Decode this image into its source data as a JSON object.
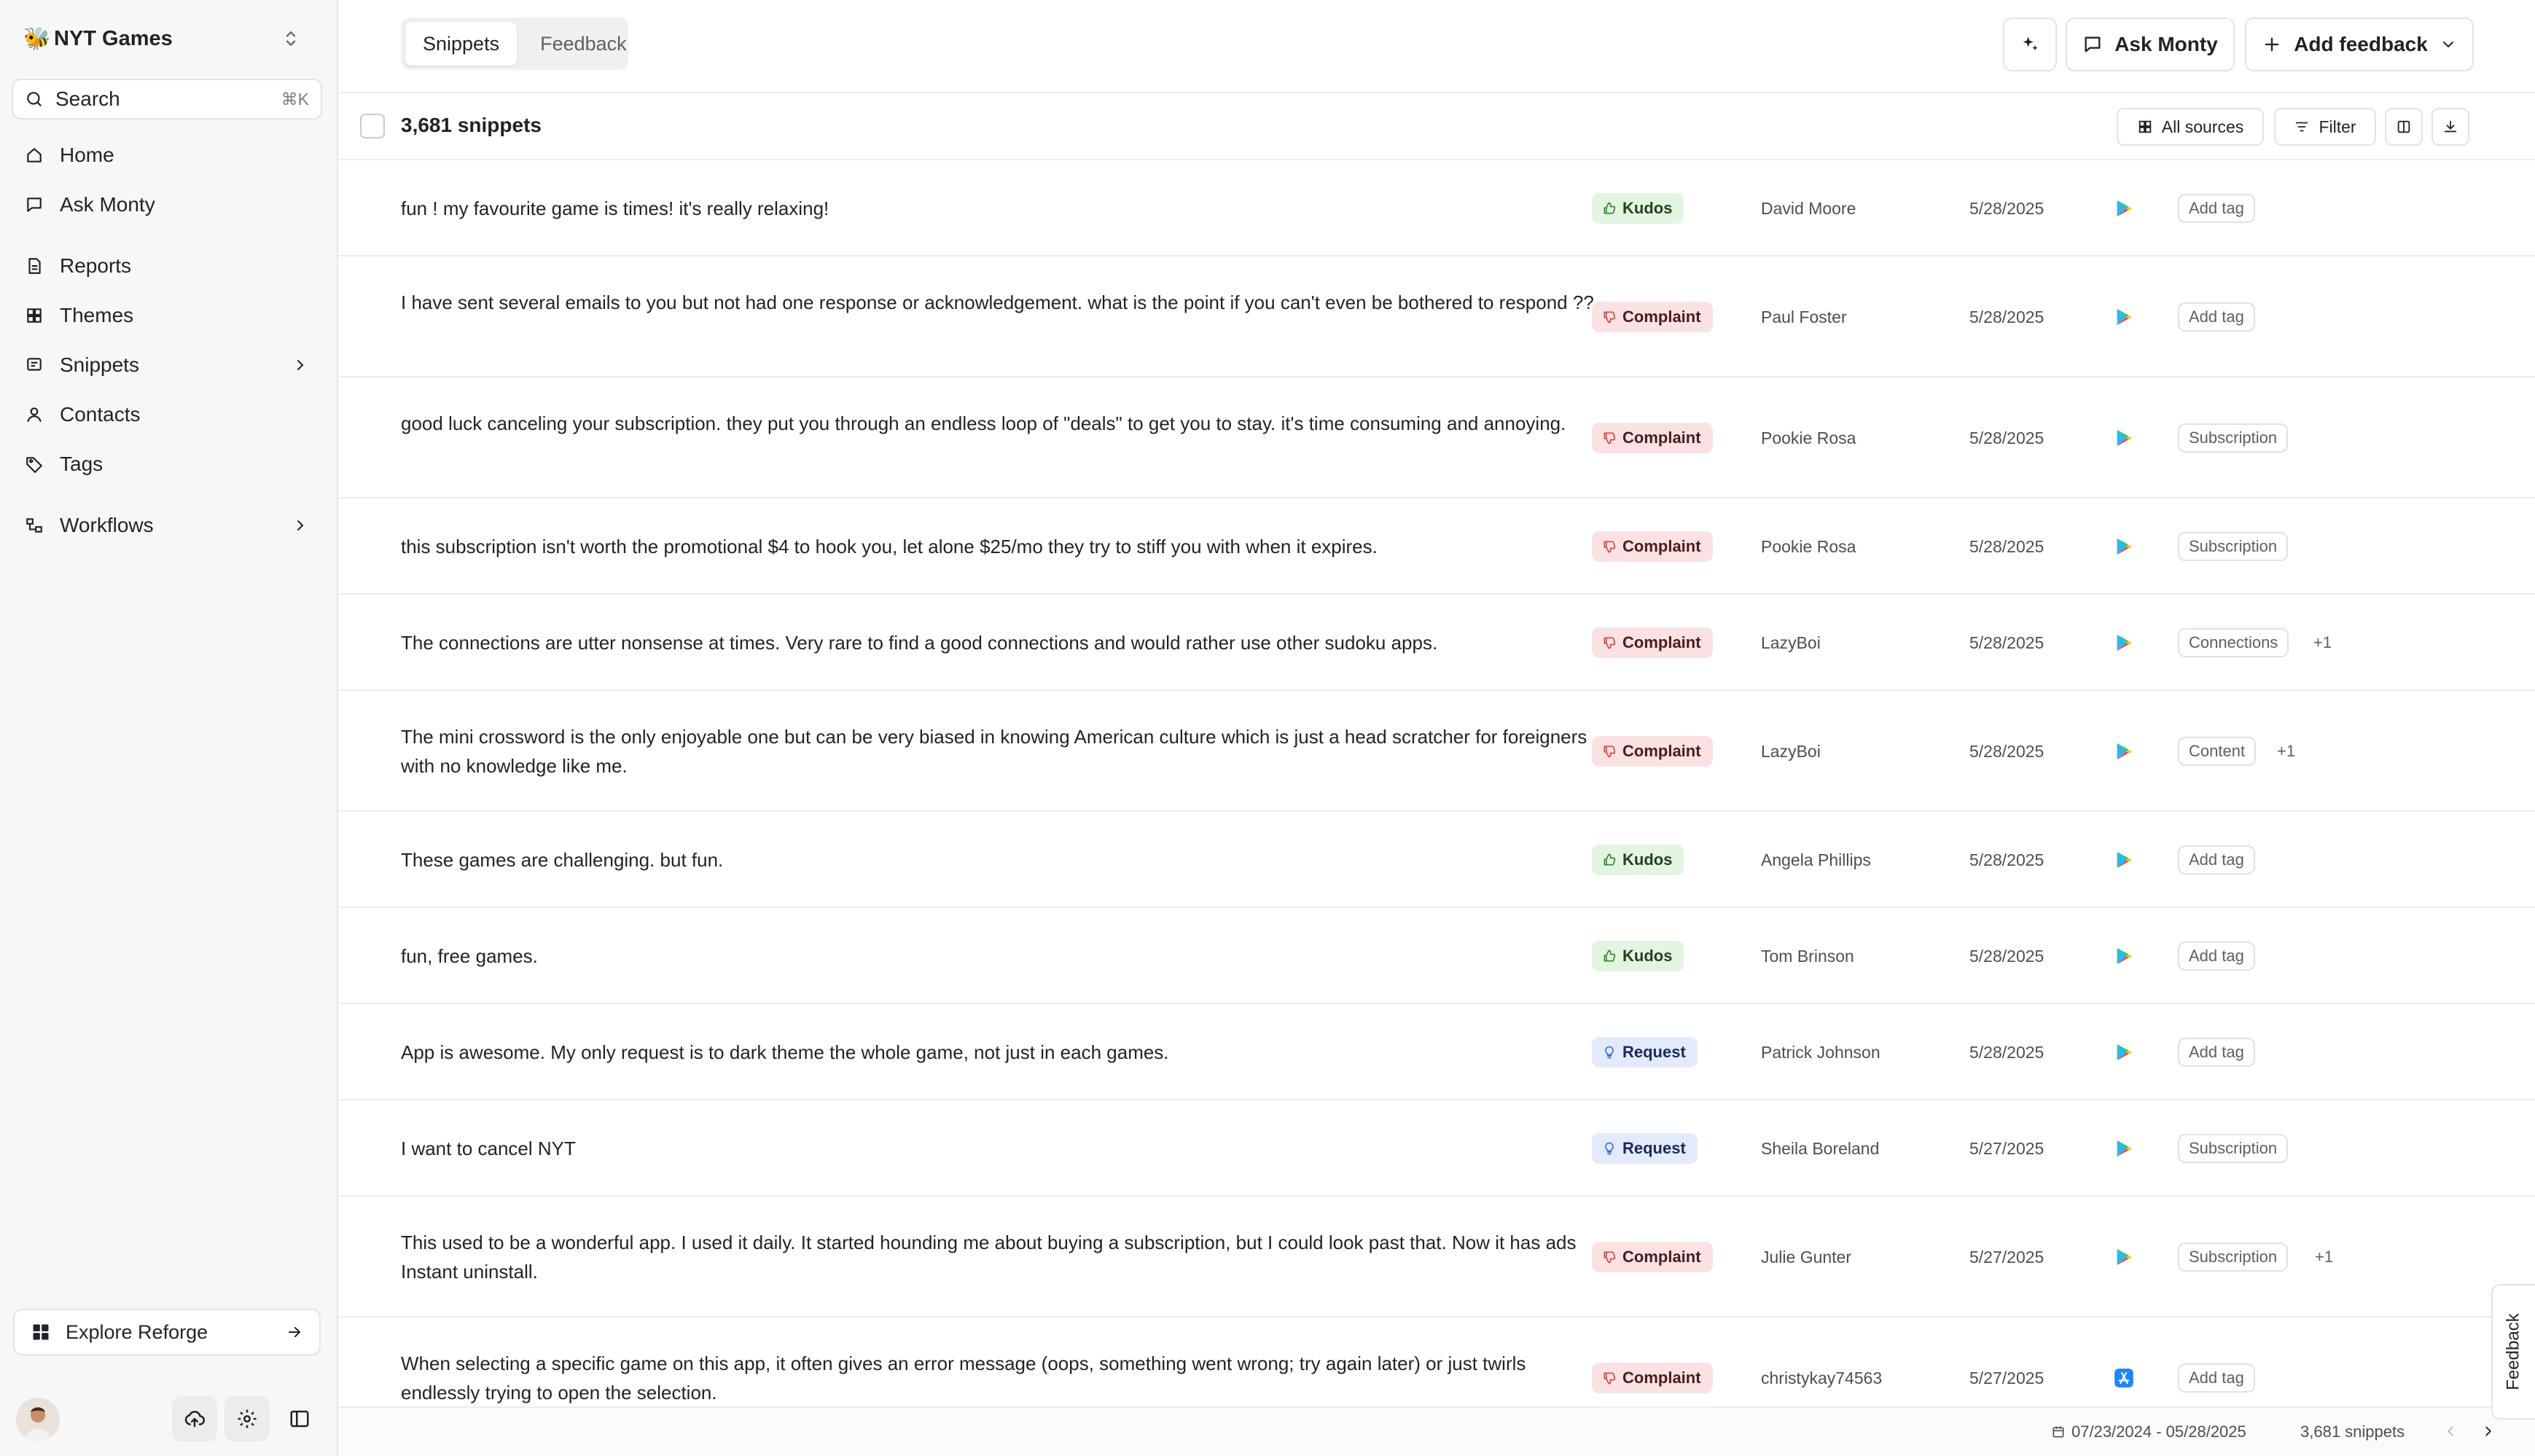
{
  "workspace": {
    "name": "NYT Games",
    "logo_icon": "bee-icon"
  },
  "search": {
    "label": "Search",
    "shortcut": "⌘K"
  },
  "sidebar": {
    "items": [
      {
        "label": "Home",
        "icon": "home-icon"
      },
      {
        "label": "Ask Monty",
        "icon": "chat-icon"
      },
      {
        "label": "Reports",
        "icon": "report-icon"
      },
      {
        "label": "Themes",
        "icon": "grid-icon"
      },
      {
        "label": "Snippets",
        "icon": "snippet-icon",
        "has_children": true
      },
      {
        "label": "Contacts",
        "icon": "person-icon"
      },
      {
        "label": "Tags",
        "icon": "tag-icon"
      },
      {
        "label": "Workflows",
        "icon": "workflow-icon",
        "has_children": true
      }
    ],
    "explore_label": "Explore Reforge"
  },
  "tabs": [
    {
      "label": "Snippets",
      "active": true
    },
    {
      "label": "Feedback",
      "active": false
    }
  ],
  "toolbar": {
    "ask_label": "Ask Monty",
    "add_label": "Add feedback"
  },
  "list": {
    "count_label": "3,681 snippets",
    "all_sources_label": "All sources",
    "filter_label": "Filter"
  },
  "rows": [
    {
      "text": "fun ! my favourite game is times! it's really relaxing!",
      "category": "Kudos",
      "author": "David Moore",
      "date": "5/28/2025",
      "source": "google-play",
      "tag": "Add tag",
      "extra": ""
    },
    {
      "text": "I have sent several emails to you but not had one response or acknowledgement. what is the point if you can't even be bothered to respond ??",
      "category": "Complaint",
      "author": "Paul Foster",
      "date": "5/28/2025",
      "source": "google-play",
      "tag": "Add tag",
      "extra": ""
    },
    {
      "text": "good luck canceling your subscription. they put you through an endless loop of \"deals\" to get you to stay. it's time consuming and annoying.",
      "category": "Complaint",
      "author": "Pookie Rosa",
      "date": "5/28/2025",
      "source": "google-play",
      "tag": "Subscription",
      "extra": ""
    },
    {
      "text": "this subscription isn't worth the promotional $4 to hook you, let alone $25/mo they try to stiff you with when it expires.",
      "category": "Complaint",
      "author": "Pookie Rosa",
      "date": "5/28/2025",
      "source": "google-play",
      "tag": "Subscription",
      "extra": ""
    },
    {
      "text": "The connections are utter nonsense at times. Very rare to find a good connections and would rather use other sudoku apps.",
      "category": "Complaint",
      "author": "LazyBoi",
      "date": "5/28/2025",
      "source": "google-play",
      "tag": "Connections",
      "extra": "+1"
    },
    {
      "text": "The mini crossword is the only enjoyable one but can be very biased in knowing American culture which is just a head scratcher for foreigners with no knowledge like me.",
      "category": "Complaint",
      "author": "LazyBoi",
      "date": "5/28/2025",
      "source": "google-play",
      "tag": "Content",
      "extra": "+1"
    },
    {
      "text": "These games are challenging. but fun.",
      "category": "Kudos",
      "author": "Angela Phillips",
      "date": "5/28/2025",
      "source": "google-play",
      "tag": "Add tag",
      "extra": ""
    },
    {
      "text": "fun, free games.",
      "category": "Kudos",
      "author": "Tom Brinson",
      "date": "5/28/2025",
      "source": "google-play",
      "tag": "Add tag",
      "extra": ""
    },
    {
      "text": "App is awesome. My only request is to dark theme the whole game, not just in each games.",
      "category": "Request",
      "author": "Patrick Johnson",
      "date": "5/28/2025",
      "source": "google-play",
      "tag": "Add tag",
      "extra": ""
    },
    {
      "text": "I want to cancel NYT",
      "category": "Request",
      "author": "Sheila Boreland",
      "date": "5/27/2025",
      "source": "google-play",
      "tag": "Subscription",
      "extra": ""
    },
    {
      "text": "This used to be a wonderful app. I used it daily. It started hounding me about buying a subscription, but I could look past that. Now it has ads Instant uninstall.",
      "category": "Complaint",
      "author": "Julie Gunter",
      "date": "5/27/2025",
      "source": "google-play",
      "tag": "Subscription",
      "extra": "+1"
    },
    {
      "text": "When selecting a specific game on this app, it often gives an error message (oops, something went wrong; try again later) or just twirls endlessly trying to open the selection.",
      "category": "Complaint",
      "author": "christykay74563",
      "date": "5/27/2025",
      "source": "app-store",
      "tag": "Add tag",
      "extra": ""
    }
  ],
  "footer": {
    "date_range": "07/23/2024 - 05/28/2025",
    "count_label": "3,681 snippets"
  },
  "feedback_tab_label": "Feedback",
  "colors": {
    "kudos_bg": "#e4f4e2",
    "complaint_bg": "#fbe2e2",
    "request_bg": "#e3eafc",
    "request_icon": "#3b6fe0",
    "kudos_icon": "#2e8a2a",
    "complaint_icon": "#d04545"
  }
}
